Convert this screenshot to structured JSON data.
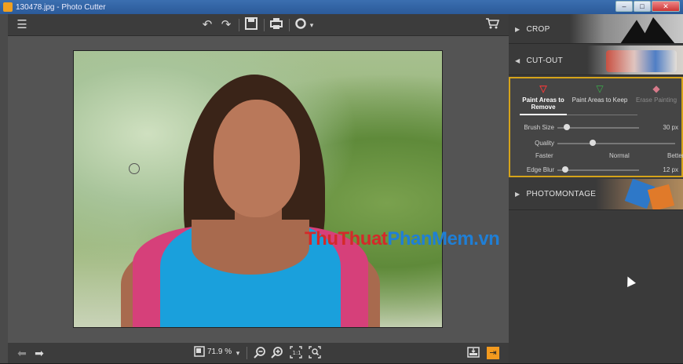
{
  "window": {
    "title": "130478.jpg - Photo Cutter",
    "controls": {
      "minimize": "–",
      "maximize": "□",
      "close": "✕"
    }
  },
  "toolbar": {
    "icons": [
      "menu-icon",
      "undo-icon",
      "redo-icon",
      "save-icon",
      "print-icon",
      "settings-icon",
      "cart-icon"
    ],
    "settings_caret": "▾"
  },
  "canvas": {
    "watermark": {
      "part1": "ThuThuat",
      "part2": "PhanMem.vn"
    }
  },
  "bottombar": {
    "zoom_value": "71.9 %",
    "zoom_caret": "▾",
    "icons": [
      "back-arrow-icon",
      "forward-arrow-icon",
      "fit-icon",
      "zoom-out-icon",
      "zoom-in-icon",
      "actual-size-icon",
      "zoom-fit-icon",
      "export-icon",
      "exit-icon"
    ]
  },
  "panel": {
    "sections": {
      "crop": {
        "label": "CROP",
        "arrow": "▶"
      },
      "cutout": {
        "label": "CUT-OUT",
        "arrow": "◀"
      },
      "photomontage": {
        "label": "PHOTOMONTAGE",
        "arrow": "▶"
      }
    },
    "tools": {
      "remove": "Paint Areas to Remove",
      "keep": "Paint Areas to Keep",
      "erase": "Erase Painting"
    },
    "brush_size": {
      "label": "Brush Size",
      "value": "30 px",
      "level": 0.12
    },
    "quality": {
      "label": "Quality",
      "level": 0.3,
      "min_label": "Faster",
      "mid_label": "Normal",
      "max_label": "Better"
    },
    "edge_blur": {
      "label": "Edge Blur",
      "value": "12 px",
      "level": 0.1
    }
  },
  "colors": {
    "accent": "#d6a41a",
    "orange": "#f39a1e",
    "watermark_red": "#d42a2a",
    "watermark_blue": "#1f7fd6"
  }
}
